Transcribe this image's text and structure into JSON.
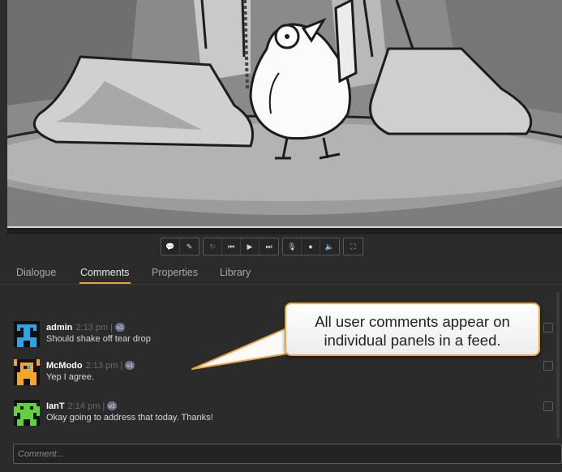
{
  "toolbar": {
    "buttons": [
      {
        "icon": "speech-bubble-icon",
        "glyph": "💬"
      },
      {
        "icon": "pencil-icon",
        "glyph": "✎"
      },
      {
        "icon": "loop-icon",
        "glyph": "↻"
      },
      {
        "icon": "skip-back-icon",
        "glyph": "⏮"
      },
      {
        "icon": "play-icon",
        "glyph": "▶"
      },
      {
        "icon": "skip-forward-icon",
        "glyph": "⏭"
      },
      {
        "icon": "microphone-icon",
        "glyph": "🎙"
      },
      {
        "icon": "record-icon",
        "glyph": "●"
      },
      {
        "icon": "volume-icon",
        "glyph": "🔈"
      },
      {
        "icon": "fullscreen-icon",
        "glyph": "⛶"
      }
    ]
  },
  "tabs": [
    {
      "label": "Dialogue",
      "active": false
    },
    {
      "label": "Comments",
      "active": true
    },
    {
      "label": "Properties",
      "active": false
    },
    {
      "label": "Library",
      "active": false
    }
  ],
  "accent_color": "#e8a23a",
  "comments": [
    {
      "author": "admin",
      "time": "2:13 pm",
      "separator": "|",
      "version": "v1",
      "text": "Should shake off tear drop",
      "avatar_color": "#2fa3e6"
    },
    {
      "author": "McModo",
      "time": "2:13 pm",
      "separator": "|",
      "version": "v1",
      "text": "Yep I agree.",
      "avatar_color": "#f3a72a"
    },
    {
      "author": "IanT",
      "time": "2:14 pm",
      "separator": "|",
      "version": "v1",
      "text": "Okay going to address that today. Thanks!",
      "avatar_color": "#5fd23d"
    }
  ],
  "callout": {
    "line1": "All user comments appear on",
    "line2": "individual panels in a feed."
  },
  "comment_input": {
    "placeholder": "Comment..."
  }
}
